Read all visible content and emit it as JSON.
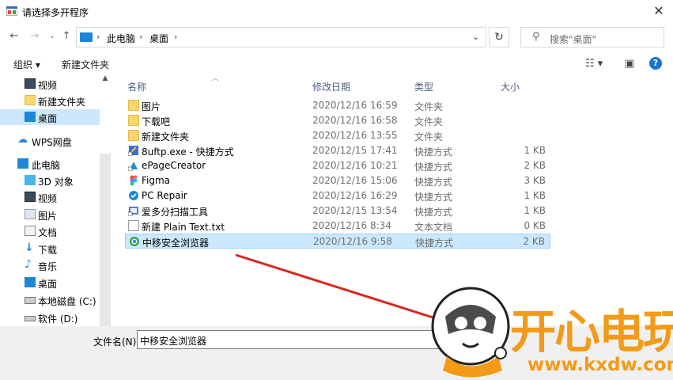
{
  "window": {
    "title": "请选择多开程序"
  },
  "nav": {
    "breadcrumb": [
      "此电脑",
      "桌面"
    ],
    "search_placeholder": "搜索\"桌面\""
  },
  "toolbar": {
    "organize_label": "组织 ▾",
    "new_folder_label": "新建文件夹"
  },
  "sidebar": {
    "items": [
      {
        "label": "视频",
        "icon": "video-icon"
      },
      {
        "label": "新建文件夹",
        "icon": "folder-icon"
      },
      {
        "label": "桌面",
        "icon": "desktop-icon",
        "selected": true
      },
      {
        "label": "WPS网盘",
        "icon": "cloud-icon"
      },
      {
        "label": "此电脑",
        "icon": "computer-icon"
      },
      {
        "label": "3D 对象",
        "icon": "3d-objects-icon"
      },
      {
        "label": "视频",
        "icon": "video-icon"
      },
      {
        "label": "图片",
        "icon": "pictures-icon"
      },
      {
        "label": "文档",
        "icon": "documents-icon"
      },
      {
        "label": "下载",
        "icon": "download-icon"
      },
      {
        "label": "音乐",
        "icon": "music-icon"
      },
      {
        "label": "桌面",
        "icon": "desktop-icon"
      },
      {
        "label": "本地磁盘 (C:)",
        "icon": "drive-c-icon"
      },
      {
        "label": "软件 (D:)",
        "icon": "drive-d-icon"
      }
    ]
  },
  "columns": {
    "name": "名称",
    "date": "修改日期",
    "type": "类型",
    "size": "大小"
  },
  "files": [
    {
      "name": "图片",
      "date": "2020/12/16 16:59",
      "type": "文件夹",
      "size": "",
      "icon": "folder-icon"
    },
    {
      "name": "下载吧",
      "date": "2020/12/16 16:58",
      "type": "文件夹",
      "size": "",
      "icon": "folder-icon"
    },
    {
      "name": "新建文件夹",
      "date": "2020/12/16 13:55",
      "type": "文件夹",
      "size": "",
      "icon": "folder-icon"
    },
    {
      "name": "8uftp.exe - 快捷方式",
      "date": "2020/12/15 17:41",
      "type": "快捷方式",
      "size": "1 KB",
      "icon": "shortcut-icon"
    },
    {
      "name": "ePageCreator",
      "date": "2020/12/16 10:21",
      "type": "快捷方式",
      "size": "2 KB",
      "icon": "shortcut-icon"
    },
    {
      "name": "Figma",
      "date": "2020/12/16 15:06",
      "type": "快捷方式",
      "size": "3 KB",
      "icon": "figma-icon"
    },
    {
      "name": "PC Repair",
      "date": "2020/12/16 16:29",
      "type": "快捷方式",
      "size": "1 KB",
      "icon": "shortcut-icon"
    },
    {
      "name": "爱多分扫描工具",
      "date": "2020/12/15 13:54",
      "type": "快捷方式",
      "size": "1 KB",
      "icon": "shortcut-icon"
    },
    {
      "name": "新建 Plain Text.txt",
      "date": "2020/12/16 8:34",
      "type": "文本文档",
      "size": "0 KB",
      "icon": "text-file-icon"
    },
    {
      "name": "中移安全浏览器",
      "date": "2020/12/16 9:58",
      "type": "快捷方式",
      "size": "2 KB",
      "icon": "browser-icon",
      "selected": true
    }
  ],
  "footer": {
    "filename_label": "文件名(N):",
    "filename_value": "中移安全浏览器"
  },
  "watermark": {
    "brand": "开心电玩",
    "url": "www.kxdw.com"
  },
  "colors": {
    "selection": "#cce8ff",
    "accent": "#1a73d1",
    "watermark": "#f39a18",
    "annotation_arrow": "#d9261c"
  }
}
